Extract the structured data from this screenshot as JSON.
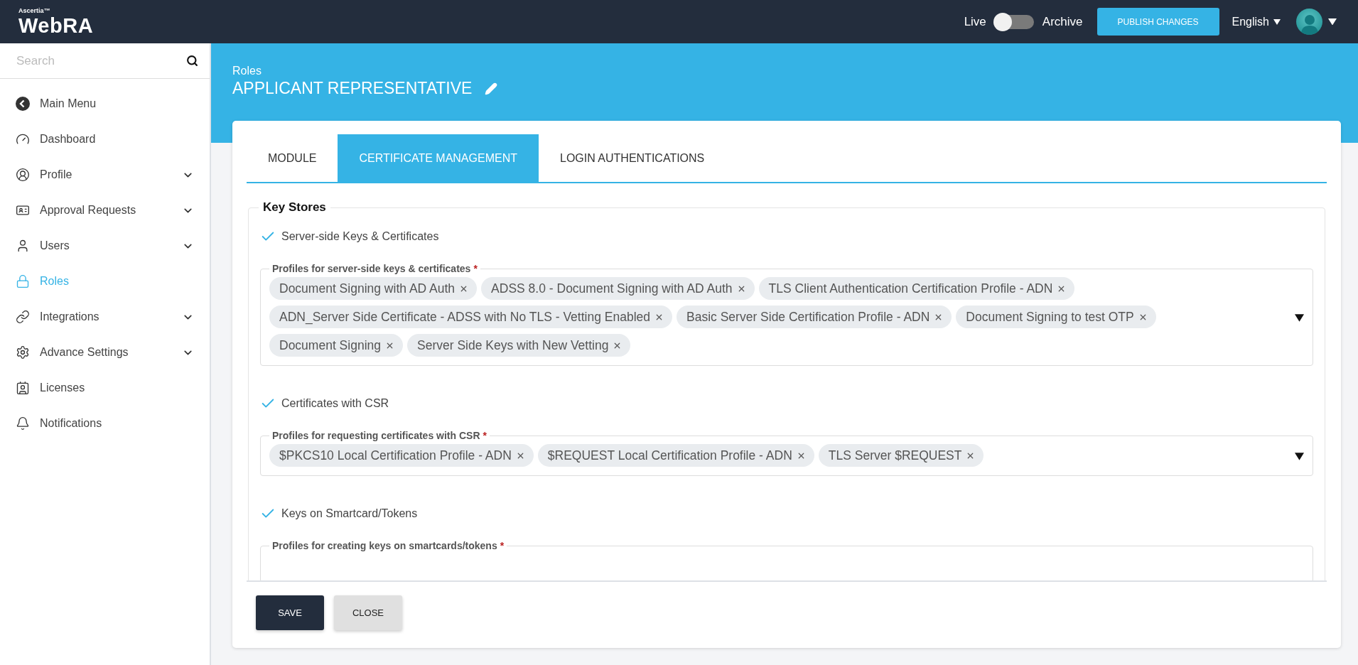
{
  "header": {
    "brand_small": "Ascertia™",
    "brand": "WebRA",
    "mode_toggle": {
      "left_label": "Live",
      "right_label": "Archive",
      "archive": false
    },
    "publish_button": "PUBLISH CHANGES",
    "language": "English"
  },
  "sidebar": {
    "search": {
      "placeholder": "Search"
    },
    "items": [
      {
        "label": "Main Menu",
        "expandable": false,
        "selected": false
      },
      {
        "label": "Dashboard",
        "expandable": false,
        "selected": false
      },
      {
        "label": "Profile",
        "expandable": true,
        "selected": false
      },
      {
        "label": "Approval Requests",
        "expandable": true,
        "selected": false
      },
      {
        "label": "Users",
        "expandable": true,
        "selected": false
      },
      {
        "label": "Roles",
        "expandable": false,
        "selected": true
      },
      {
        "label": "Integrations",
        "expandable": true,
        "selected": false
      },
      {
        "label": "Advance Settings",
        "expandable": true,
        "selected": false
      },
      {
        "label": "Licenses",
        "expandable": false,
        "selected": false
      },
      {
        "label": "Notifications",
        "expandable": false,
        "selected": false
      }
    ]
  },
  "page": {
    "breadcrumb": "Roles",
    "title": "APPLICANT REPRESENTATIVE"
  },
  "tabs": [
    {
      "label": "MODULE",
      "selected": false
    },
    {
      "label": "CERTIFICATE MANAGEMENT",
      "selected": true
    },
    {
      "label": "LOGIN AUTHENTICATIONS",
      "selected": false
    }
  ],
  "key_stores": {
    "title": "Key Stores",
    "sections": [
      {
        "label": "Server-side Keys & Certificates",
        "checked": true,
        "field": {
          "label": "Profiles for server-side keys & certificates",
          "required_mark": "*",
          "chips": [
            "Document Signing with AD Auth",
            "ADSS 8.0 - Document Signing with AD Auth",
            "TLS Client Authentication Certification Profile - ADN",
            "ADN_Server Side Certificate - ADSS with No TLS - Vetting Enabled",
            "Basic Server Side Certification Profile - ADN",
            "Document Signing to test OTP",
            "Document Signing",
            "Server Side Keys with New Vetting"
          ]
        }
      },
      {
        "label": "Certificates with CSR",
        "checked": true,
        "field": {
          "label": "Profiles for requesting certificates with CSR",
          "required_mark": "*",
          "chips": [
            "$PKCS10 Local Certification Profile - ADN",
            "$REQUEST Local Certification Profile - ADN",
            "TLS Server $REQUEST"
          ]
        }
      },
      {
        "label": "Keys on Smartcard/Tokens",
        "checked": true,
        "field": {
          "label": "Profiles for creating keys on smartcards/tokens",
          "required_mark": "*"
        }
      }
    ]
  },
  "buttons": [
    {
      "label": "SAVE",
      "kind": "primary"
    },
    {
      "label": "CLOSE",
      "kind": "secondary"
    }
  ]
}
